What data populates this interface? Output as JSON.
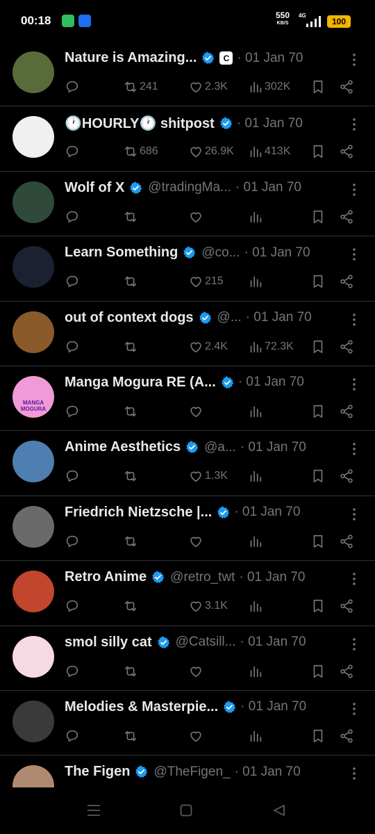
{
  "status_bar": {
    "time": "00:18",
    "net_speed_value": "550",
    "net_speed_unit": "KB/S",
    "net_type": "4G",
    "battery": "100"
  },
  "feed": [
    {
      "name": "Nature is Amazing...",
      "handle": "",
      "date": "· 01 Jan 70",
      "badge": "C",
      "retweets": "241",
      "likes": "2.3K",
      "views": "302K",
      "avatar_color": "#5a6b3a"
    },
    {
      "name": "🕐HOURLY🕐 shitpost",
      "handle": "",
      "date": "· 01 Jan 70",
      "badge": "",
      "retweets": "686",
      "likes": "26.9K",
      "views": "413K",
      "avatar_color": "#f0f0f0"
    },
    {
      "name": "Wolf of X",
      "handle": "@tradingMa...",
      "date": "· 01 Jan 70",
      "badge": "",
      "retweets": "",
      "likes": "",
      "views": "",
      "avatar_color": "#2f4a3a"
    },
    {
      "name": "Learn Something",
      "handle": "@co...",
      "date": "· 01 Jan 70",
      "badge": "",
      "retweets": "",
      "likes": "215",
      "views": "",
      "avatar_color": "#1b2130"
    },
    {
      "name": "out of context dogs",
      "handle": "@...",
      "date": "· 01 Jan 70",
      "badge": "",
      "retweets": "",
      "likes": "2.4K",
      "views": "72.3K",
      "avatar_color": "#8a5a2a"
    },
    {
      "name": "Manga Mogura RE (A...",
      "handle": "",
      "date": "· 01 Jan 70",
      "badge": "",
      "retweets": "",
      "likes": "",
      "views": "",
      "avatar_color": "#f19ad8",
      "avatar_text": "MANGA MOGURA"
    },
    {
      "name": "Anime Aesthetics",
      "handle": "@a...",
      "date": "· 01 Jan 70",
      "badge": "",
      "retweets": "",
      "likes": "1.3K",
      "views": "",
      "avatar_color": "#4f7fb0"
    },
    {
      "name": "Friedrich Nietzsche |...",
      "handle": "",
      "date": "· 01 Jan 70",
      "badge": "",
      "retweets": "",
      "likes": "",
      "views": "",
      "avatar_color": "#6a6a6a"
    },
    {
      "name": "Retro Anime",
      "handle": "@retro_twt",
      "date": "· 01 Jan 70",
      "badge": "",
      "retweets": "",
      "likes": "3.1K",
      "views": "",
      "avatar_color": "#c2452e"
    },
    {
      "name": "smol silly cat",
      "handle": "@Catsill...",
      "date": "· 01 Jan 70",
      "badge": "",
      "retweets": "",
      "likes": "",
      "views": "",
      "avatar_color": "#f7d9e3"
    },
    {
      "name": "Melodies & Masterpie...",
      "handle": "",
      "date": "· 01 Jan 70",
      "badge": "",
      "retweets": "",
      "likes": "",
      "views": "",
      "avatar_color": "#3a3a3a"
    },
    {
      "name": "The Figen",
      "handle": "@TheFigen_",
      "date": "· 01 Jan 70",
      "badge": "",
      "retweets": "",
      "likes": "",
      "views": "",
      "avatar_color": "#b08a70"
    }
  ],
  "colors": {
    "verified": "#1d9bf0",
    "muted": "#71767b",
    "divider": "#2f3336"
  },
  "icons": [
    "reply-icon",
    "retweet-icon",
    "like-icon",
    "views-icon",
    "bookmark-icon",
    "share-icon",
    "more-icon",
    "verified-icon"
  ],
  "navbar": [
    "menu-icon",
    "home-icon",
    "back-icon"
  ]
}
